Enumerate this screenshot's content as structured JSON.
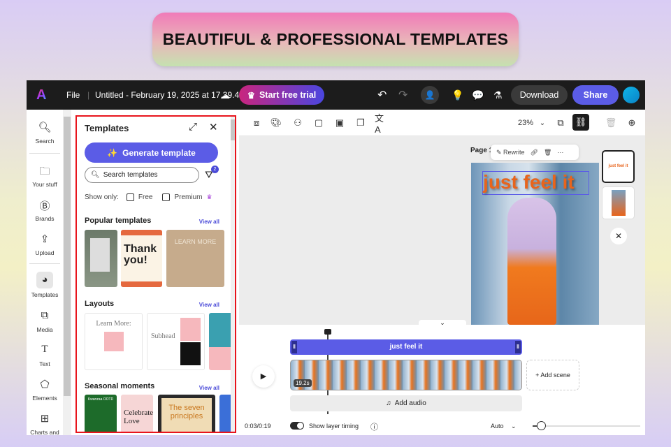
{
  "banner": {
    "text": "BEAUTIFUL & PROFESSIONAL TEMPLATES"
  },
  "topbar": {
    "file": "File",
    "doc_title": "Untitled - February 19, 2025 at 17.39.42",
    "trial": "Start free trial",
    "download": "Download",
    "share": "Share"
  },
  "rail": [
    {
      "label": "Search",
      "icon": "search-icon"
    },
    {
      "label": "Your stuff",
      "icon": "folder-icon"
    },
    {
      "label": "Brands",
      "icon": "brand-icon"
    },
    {
      "label": "Upload",
      "icon": "upload-icon"
    },
    {
      "label": "Templates",
      "icon": "templates-icon"
    },
    {
      "label": "Media",
      "icon": "media-icon"
    },
    {
      "label": "Text",
      "icon": "text-icon"
    },
    {
      "label": "Elements",
      "icon": "elements-icon"
    },
    {
      "label": "Charts and",
      "icon": "charts-icon"
    }
  ],
  "panel": {
    "title": "Templates",
    "generate": "Generate template",
    "search_placeholder": "Search templates",
    "filter_count": "2",
    "show_only": "Show only:",
    "free": "Free",
    "premium": "Premium",
    "popular": "Popular templates",
    "layouts": "Layouts",
    "seasonal": "Seasonal moments",
    "view_all": "View all",
    "thumbs": {
      "thank": "Thank you!",
      "learn": "LEARN MORE",
      "learn2": "Learn More:",
      "subhead": "Subhead",
      "kwanzaa": "Kwanzaa OOTD",
      "celebrate": "Celebrate Love",
      "seven": "The seven principles"
    }
  },
  "toolbar": {
    "zoom": "23%"
  },
  "canvas": {
    "page_label": "Page 1",
    "rewrite": "Rewrite",
    "headline": "just feel it",
    "thumb1_text": "just feel it",
    "accent": "#e8641c"
  },
  "timeline": {
    "layer": "just feel it",
    "duration": "19.2s",
    "add_scene": "+ Add scene",
    "add_audio": "Add audio",
    "time": "0:03/0:19",
    "show_timing": "Show layer timing",
    "auto": "Auto",
    "toggle_on": true,
    "accent": "#5b5ce6"
  }
}
